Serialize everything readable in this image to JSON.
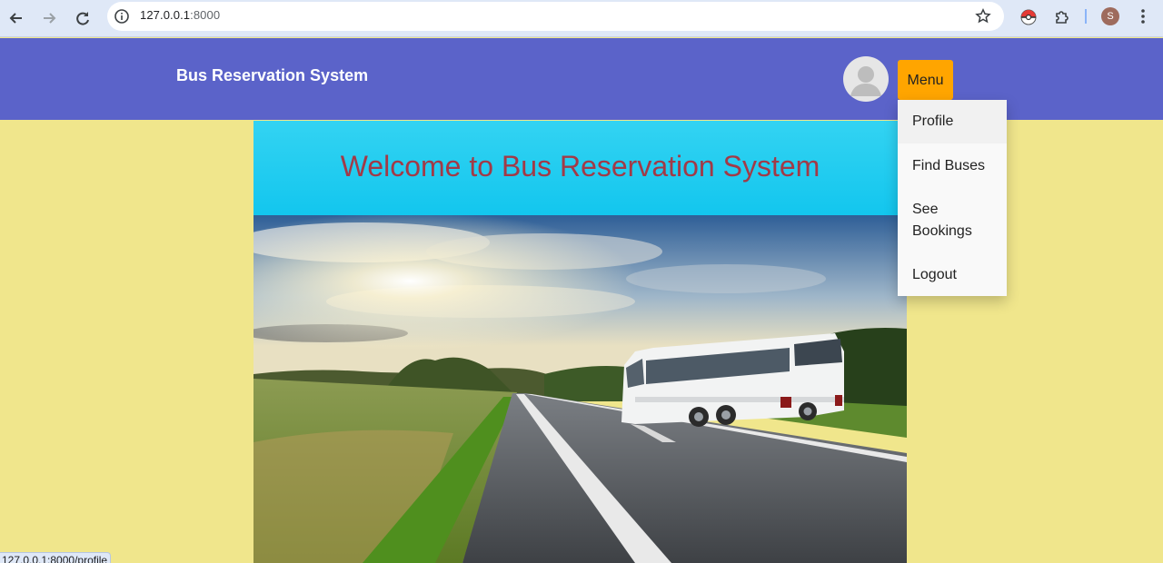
{
  "browser": {
    "url_host": "127.0.0.1",
    "url_port": ":8000",
    "profile_initial": "S",
    "status_url": "127.0.0.1:8000/profile"
  },
  "header": {
    "title": "Bus Reservation System",
    "menu_label": "Menu",
    "background_color": "#5b63c9",
    "menu_color": "#ffa500"
  },
  "menu": {
    "items": [
      {
        "label": "Profile"
      },
      {
        "label": "Find Buses"
      },
      {
        "label": "See Bookings"
      },
      {
        "label": "Logout"
      }
    ]
  },
  "banner": {
    "title": "Welcome to Bus Reservation System",
    "title_color": "#a23a47"
  },
  "page": {
    "background_color": "#f0e68c"
  }
}
